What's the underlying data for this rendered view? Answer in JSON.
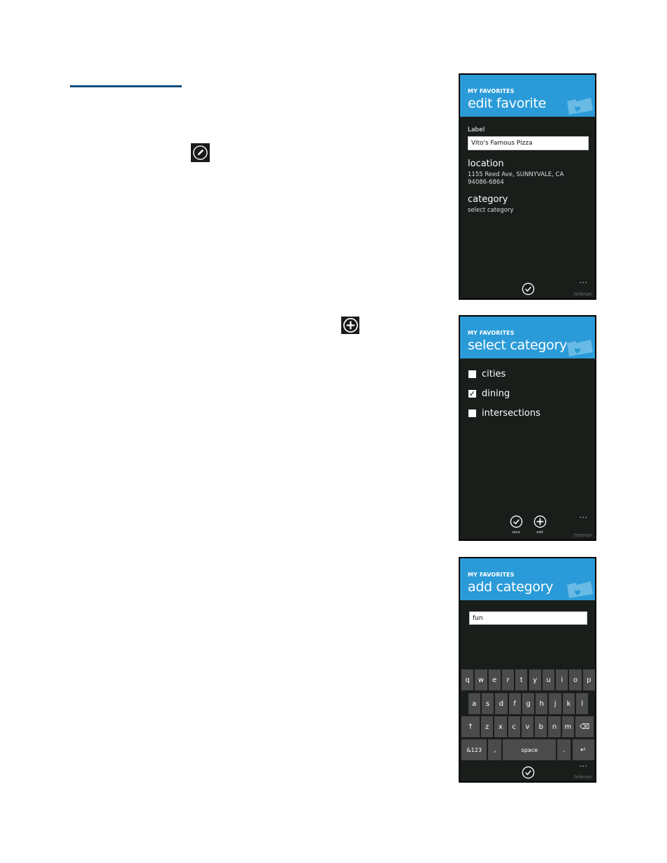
{
  "document": {
    "inline_icons": {
      "edit": "pencil-icon",
      "add": "plus-circle-icon"
    },
    "accent_rule_color": "#0f4c7c"
  },
  "theme": {
    "header_color": "#2a9bd8",
    "background_color": "#1a1e1b",
    "key_color": "#4a4b4a"
  },
  "screens": {
    "edit_favorite": {
      "app_name": "MY FAVORITES",
      "title": "edit favorite",
      "label_caption": "Label",
      "label_value": "Vito's Famous Pizza",
      "location_heading": "location",
      "location_line1": "1155 Reed Ave, SUNNYVALE, CA",
      "location_line2": "94086-6864",
      "category_heading": "category",
      "category_value": "select category",
      "appbar": {
        "buttons": [
          {
            "icon": "check-icon",
            "label": ""
          }
        ],
        "more": "..."
      },
      "brand": "telenav"
    },
    "select_category": {
      "app_name": "MY FAVORITES",
      "title": "select category",
      "options": [
        {
          "label": "cities",
          "checked": false
        },
        {
          "label": "dining",
          "checked": true
        },
        {
          "label": "intersections",
          "checked": false
        }
      ],
      "appbar": {
        "buttons": [
          {
            "icon": "check-icon",
            "label": "save"
          },
          {
            "icon": "plus-icon",
            "label": "add"
          }
        ],
        "more": "..."
      },
      "brand": "telenav"
    },
    "add_category": {
      "app_name": "MY FAVORITES",
      "title": "add category",
      "input_value": "fun",
      "keyboard": {
        "row1": [
          "q",
          "w",
          "e",
          "r",
          "t",
          "y",
          "u",
          "i",
          "o",
          "p"
        ],
        "row2": [
          "a",
          "s",
          "d",
          "f",
          "g",
          "h",
          "j",
          "k",
          "l"
        ],
        "row3": [
          "↑",
          "z",
          "x",
          "c",
          "v",
          "b",
          "n",
          "m",
          "⌫"
        ],
        "row4": [
          "&123",
          ",",
          "space",
          ".",
          "↵"
        ]
      },
      "appbar": {
        "buttons": [
          {
            "icon": "check-icon",
            "label": ""
          }
        ],
        "more": "..."
      },
      "brand": "telenav"
    }
  }
}
